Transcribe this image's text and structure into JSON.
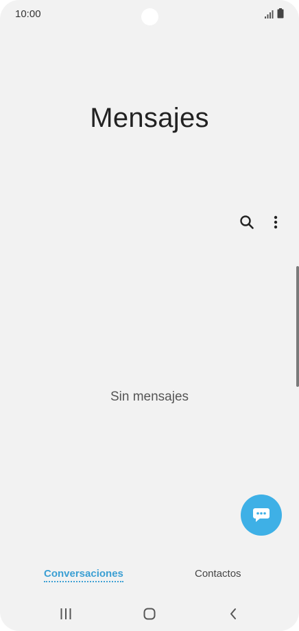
{
  "status_bar": {
    "time": "10:00",
    "icons": [
      "signal-icon",
      "battery-icon"
    ]
  },
  "app": {
    "title": "Mensajes"
  },
  "toolbar": {
    "icons": [
      "search-icon",
      "more-options-icon"
    ]
  },
  "conversations": {
    "empty_text": "Sin mensajes"
  },
  "fab": {
    "icon": "compose-message-icon"
  },
  "tabs": [
    {
      "label": "Conversaciones",
      "active": true
    },
    {
      "label": "Contactos",
      "active": false
    }
  ],
  "nav_bar": {
    "icons": [
      "recent-apps-icon",
      "home-icon",
      "back-icon"
    ]
  },
  "colors": {
    "accent": "#3b9fd3",
    "fab_background": "#3eb0e6",
    "background": "#f2f2f2"
  }
}
